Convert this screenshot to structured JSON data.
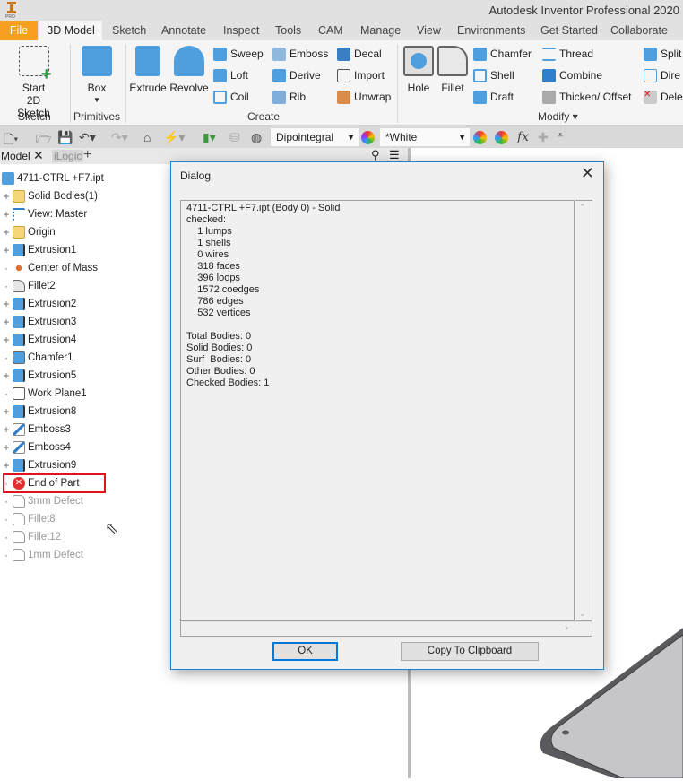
{
  "app": {
    "title": "Autodesk Inventor Professional 2020",
    "logo_text": "PRO"
  },
  "tabs": [
    "File",
    "3D Model",
    "Sketch",
    "Annotate",
    "Inspect",
    "Tools",
    "CAM",
    "Manage",
    "View",
    "Environments",
    "Get Started",
    "Collaborate"
  ],
  "ribbon": {
    "sketch": {
      "start_line1": "Start",
      "start_line2": "2D Sketch",
      "group": "Sketch"
    },
    "primitives": {
      "box": "Box",
      "group": "Primitives"
    },
    "create": {
      "extrude": "Extrude",
      "revolve": "Revolve",
      "sweep": "Sweep",
      "loft": "Loft",
      "coil": "Coil",
      "emboss": "Emboss",
      "derive": "Derive",
      "rib": "Rib",
      "decal": "Decal",
      "import": "Import",
      "unwrap": "Unwrap",
      "group": "Create"
    },
    "modify": {
      "hole": "Hole",
      "fillet": "Fillet",
      "chamfer": "Chamfer",
      "shell": "Shell",
      "draft": "Draft",
      "thread": "Thread",
      "combine": "Combine",
      "thicken": "Thicken/ Offset",
      "split": "Split",
      "direct": "Dire",
      "delete": "Dele",
      "group": "Modify ▾"
    }
  },
  "qat": {
    "material": "Dipointegral",
    "appearance": "*White"
  },
  "browser": {
    "tab_model": "Model",
    "tab_ilogic": "iLogic",
    "items": [
      {
        "label": "4711-CTRL +F7.ipt",
        "icon": "part",
        "expand": false,
        "indent": 0
      },
      {
        "label": "Solid Bodies(1)",
        "icon": "folder",
        "expand": true
      },
      {
        "label": "View: Master",
        "icon": "view",
        "expand": true
      },
      {
        "label": "Origin",
        "icon": "folder",
        "expand": true
      },
      {
        "label": "Extrusion1",
        "icon": "extrude",
        "expand": true
      },
      {
        "label": "Center of Mass",
        "icon": "com",
        "expand": false
      },
      {
        "label": "Fillet2",
        "icon": "fillet",
        "expand": false
      },
      {
        "label": "Extrusion2",
        "icon": "extrude",
        "expand": true
      },
      {
        "label": "Extrusion3",
        "icon": "extrude",
        "expand": true
      },
      {
        "label": "Extrusion4",
        "icon": "extrude",
        "expand": true
      },
      {
        "label": "Chamfer1",
        "icon": "chamfer",
        "expand": false
      },
      {
        "label": "Extrusion5",
        "icon": "extrude",
        "expand": true
      },
      {
        "label": "Work Plane1",
        "icon": "plane",
        "expand": false
      },
      {
        "label": "Extrusion8",
        "icon": "extrude",
        "expand": true
      },
      {
        "label": "Emboss3",
        "icon": "emboss",
        "expand": true
      },
      {
        "label": "Emboss4",
        "icon": "emboss",
        "expand": true
      },
      {
        "label": "Extrusion9",
        "icon": "extrude",
        "expand": true
      },
      {
        "label": "End of Part",
        "icon": "eop",
        "expand": false
      },
      {
        "label": "3mm Defect",
        "icon": "suppressed",
        "expand": false,
        "dim": true
      },
      {
        "label": "Fillet8",
        "icon": "suppressed",
        "expand": false,
        "dim": true
      },
      {
        "label": "Fillet12",
        "icon": "suppressed",
        "expand": false,
        "dim": true
      },
      {
        "label": "1mm Defect",
        "icon": "suppressed",
        "expand": false,
        "dim": true
      }
    ]
  },
  "dialog": {
    "title": "Dialog",
    "text": "4711-CTRL +F7.ipt (Body 0) - Solid\nchecked:\n    1 lumps\n    1 shells\n    0 wires\n    318 faces\n    396 loops\n    1572 coedges\n    786 edges\n    532 vertices\n\nTotal Bodies: 0\nSolid Bodies: 0\nSurf  Bodies: 0\nOther Bodies: 0\nChecked Bodies: 1",
    "ok": "OK",
    "copy": "Copy To Clipboard"
  },
  "colors": {
    "file_tab": "#f5a01f",
    "dialog_border": "#1883d7",
    "highlight": "#e0141e",
    "icon_blue": "#4f9fde"
  }
}
